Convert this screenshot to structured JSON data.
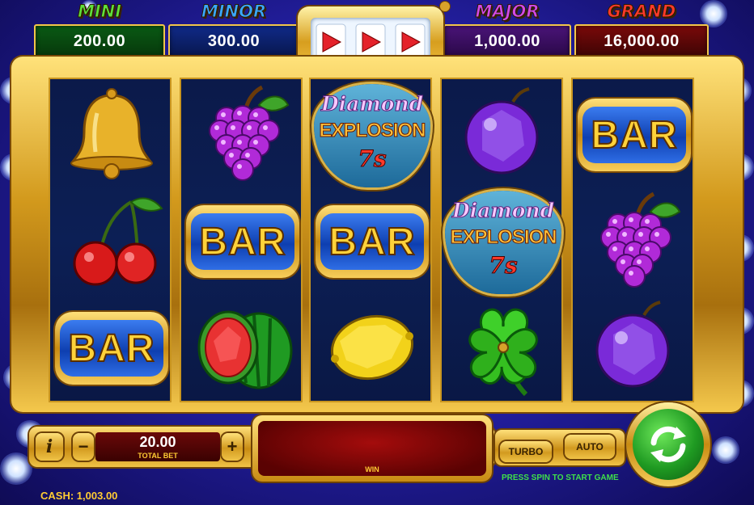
{
  "jackpots": [
    {
      "title": "MINI",
      "value": "200.00",
      "title_color": "#5fe03a",
      "panel_color": "#0e4a12"
    },
    {
      "title": "MINOR",
      "value": "300.00",
      "title_color": "#3aa8ff",
      "panel_color": "#0c1e6a"
    },
    {
      "title": "MAJOR",
      "value": "1,000.00",
      "title_color": "#d24ae8",
      "panel_color": "#3a0c5e"
    },
    {
      "title": "GRAND",
      "value": "16,000.00",
      "title_color": "#ff3a2a",
      "panel_color": "#5a0808"
    }
  ],
  "reels": [
    [
      "bell",
      "cherries",
      "bar"
    ],
    [
      "grapes",
      "bar",
      "watermelon"
    ],
    [
      "diamond-explosion-7s",
      "bar",
      "lemon"
    ],
    [
      "plum",
      "diamond-explosion-7s",
      "clover"
    ],
    [
      "bar",
      "grapes",
      "plum"
    ]
  ],
  "symbols": {
    "bar_text": "BAR",
    "logo_line1": "Diamond",
    "logo_line2": "EXPLOSION",
    "logo_line3": "7s"
  },
  "controls": {
    "info_label": "i",
    "minus_label": "−",
    "plus_label": "+",
    "bet_value": "20.00",
    "bet_label": "TOTAL BET",
    "win_label": "WIN",
    "turbo_label": "TURBO",
    "auto_label": "AUTO",
    "status_message": "PRESS SPIN TO START GAME",
    "cash_label": "CASH:",
    "cash_value": "1,003.00"
  },
  "colors": {
    "accent_gold": "#f2c649",
    "spin_green": "#2fb52f",
    "status_green": "#3fe04a"
  }
}
